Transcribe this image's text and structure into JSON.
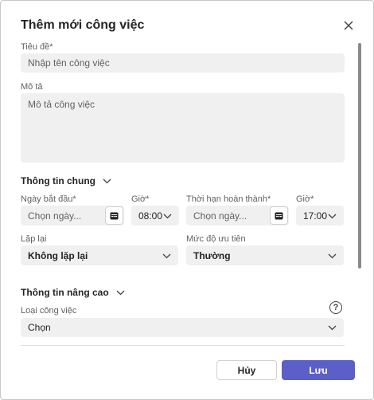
{
  "dialog": {
    "title": "Thêm mới công việc",
    "close_icon": "close-icon"
  },
  "fields": {
    "title_label": "Tiêu đề*",
    "title_placeholder": "Nhập tên công việc",
    "desc_label": "Mô tả",
    "desc_placeholder": "Mô tả công việc"
  },
  "general": {
    "section_label": "Thông tin chung",
    "start_date_label": "Ngày bắt đầu*",
    "start_date_placeholder": "Chọn ngày...",
    "start_time_label": "Giờ*",
    "start_time_value": "08:00",
    "due_date_label": "Thời hạn hoàn thành*",
    "due_date_placeholder": "Chọn ngày...",
    "due_time_label": "Giờ*",
    "due_time_value": "17:00",
    "repeat_label": "Lặp lại",
    "repeat_value": "Không lặp lại",
    "priority_label": "Mức độ ưu tiên",
    "priority_value": "Thường"
  },
  "advanced": {
    "section_label": "Thông tin nâng cao",
    "type_label": "Loại công việc",
    "type_value": "Chọn",
    "help_glyph": "?"
  },
  "footer": {
    "cancel_label": "Hủy",
    "save_label": "Lưu"
  },
  "colors": {
    "primary": "#5b5fc7",
    "field_bg": "#f0f0f0"
  }
}
